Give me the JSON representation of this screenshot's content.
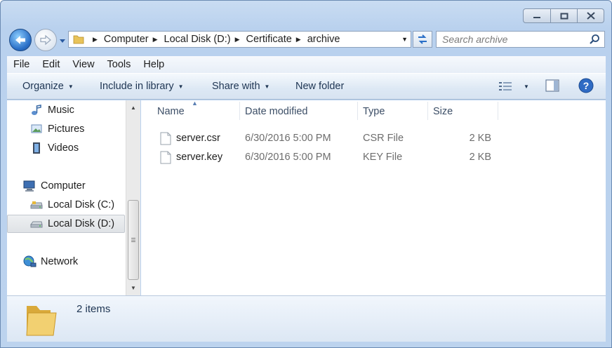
{
  "window": {
    "controls": [
      "minimize",
      "maximize",
      "close"
    ]
  },
  "address": {
    "crumbs": [
      "Computer",
      "Local Disk (D:)",
      "Certificate",
      "archive"
    ]
  },
  "search": {
    "placeholder": "Search archive"
  },
  "menu": {
    "items": [
      "File",
      "Edit",
      "View",
      "Tools",
      "Help"
    ]
  },
  "commands": {
    "organize": "Organize",
    "include": "Include in library",
    "share": "Share with",
    "new_folder": "New folder"
  },
  "nav": {
    "items": [
      {
        "label": "Music",
        "icon": "music-icon"
      },
      {
        "label": "Pictures",
        "icon": "pictures-icon"
      },
      {
        "label": "Videos",
        "icon": "videos-icon"
      },
      {
        "label": "Computer",
        "icon": "computer-icon"
      },
      {
        "label": "Local Disk (C:)",
        "icon": "drive-icon"
      },
      {
        "label": "Local Disk (D:)",
        "icon": "drive-icon",
        "selected": true
      },
      {
        "label": "Network",
        "icon": "network-icon"
      }
    ]
  },
  "columns": {
    "name": "Name",
    "date": "Date modified",
    "type": "Type",
    "size": "Size"
  },
  "files": [
    {
      "name": "server.csr",
      "date": "6/30/2016 5:00 PM",
      "type": "CSR File",
      "size": "2 KB"
    },
    {
      "name": "server.key",
      "date": "6/30/2016 5:00 PM",
      "type": "KEY File",
      "size": "2 KB"
    }
  ],
  "status": {
    "count": "2 items"
  },
  "colors": {
    "accent": "#2a6fc7",
    "window_frame": "#b9d1ee"
  }
}
